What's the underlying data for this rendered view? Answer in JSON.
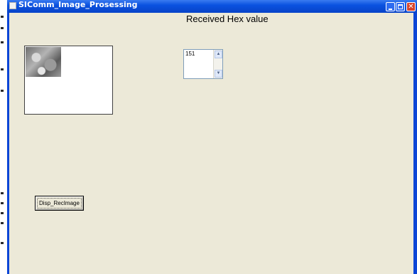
{
  "window": {
    "title": "SIComm_Image_Prosessing",
    "controls": {
      "minimize_icon": "minimize-icon",
      "maximize_icon": "maximize-icon",
      "close_icon": "close-icon"
    },
    "accent_color": "#0b45d6",
    "client_color": "#ece9d8"
  },
  "form": {
    "heading": "Received Hex value",
    "hex_textbox": {
      "value": "151"
    },
    "image_preview": {
      "icon": "grayscale-image-thumbnail"
    },
    "display_button": {
      "label": "Disp_RecImage"
    }
  }
}
